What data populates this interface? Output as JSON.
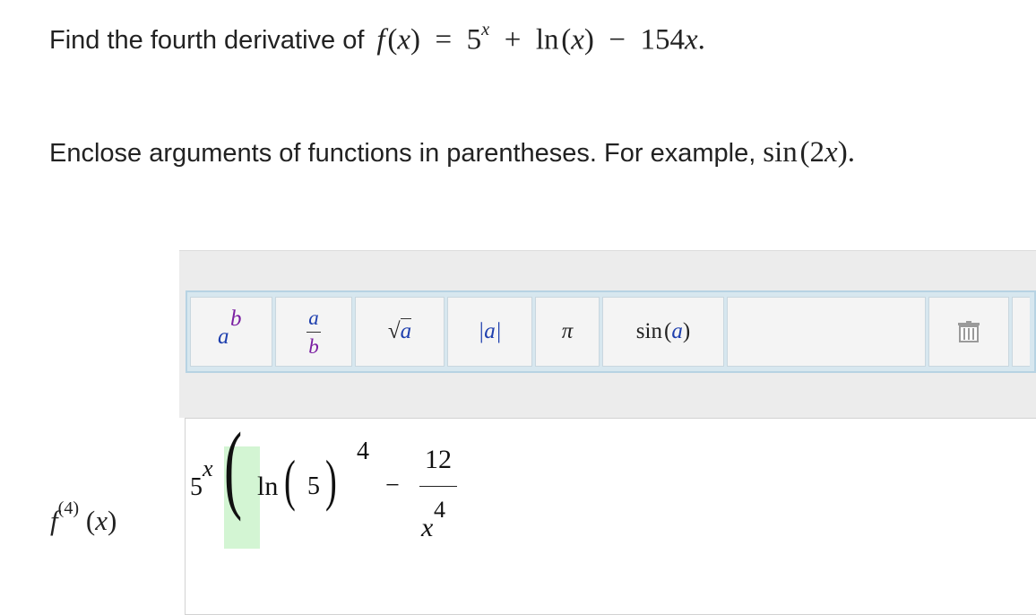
{
  "question": {
    "prefix": "Find the fourth derivative of",
    "f": "f",
    "x": "x",
    "base": "5",
    "ln": "ln",
    "minus_term": "154",
    "end": "."
  },
  "instruction": {
    "text": "Enclose arguments of functions in parentheses. For example,",
    "func": "sin",
    "arg_num": "2",
    "arg_var": "x",
    "end": "."
  },
  "toolbar": {
    "power": {
      "base": "a",
      "exp": "b"
    },
    "fraction": {
      "num": "a",
      "den": "b"
    },
    "sqrt": {
      "symbol": "√",
      "arg": "a"
    },
    "abs": {
      "text": "|a|"
    },
    "pi": {
      "text": "π"
    },
    "sin": {
      "func": "sin",
      "arg": "a"
    },
    "clear_icon": "trash-icon"
  },
  "answer": {
    "label_f": "f",
    "label_order": "(4)",
    "label_var": "x",
    "base": "5",
    "base_exp": "x",
    "ln": "ln",
    "ln_arg": "5",
    "outer_exp": "4",
    "minus": "−",
    "frac_num": "12",
    "frac_den_var": "x",
    "frac_den_exp": "4"
  }
}
